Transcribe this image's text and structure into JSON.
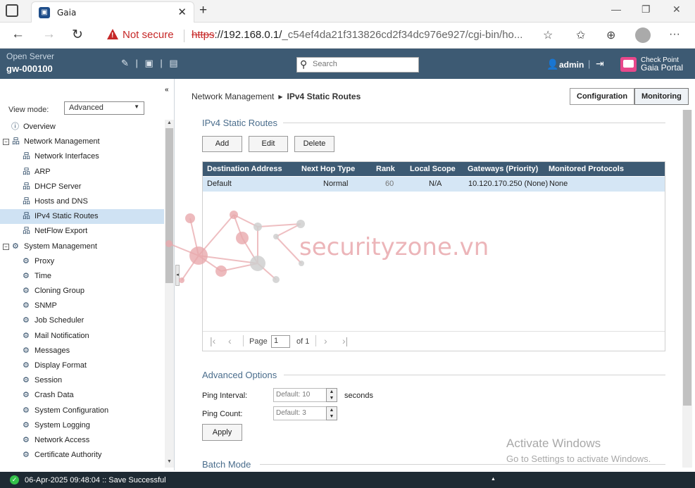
{
  "browser": {
    "tab_title": "Gaia",
    "not_secure": "Not secure",
    "url_scheme": "https",
    "url_host": "://192.168.0.1/",
    "url_path": "_c54ef4da21f313826cd2f34dc976e927/cgi-bin/ho..."
  },
  "header": {
    "server_type": "Open Server",
    "hostname": "gw-000100",
    "search_placeholder": "Search",
    "user": "admin",
    "brand_line1": "Check Point",
    "brand_line2": "Gaia Portal"
  },
  "sidebar": {
    "view_mode_label": "View mode:",
    "view_mode_value": "Advanced",
    "items": [
      {
        "label": "Overview"
      },
      {
        "label": "Network Management"
      },
      {
        "label": "Network Interfaces"
      },
      {
        "label": "ARP"
      },
      {
        "label": "DHCP Server"
      },
      {
        "label": "Hosts and DNS"
      },
      {
        "label": "IPv4 Static Routes"
      },
      {
        "label": "NetFlow Export"
      },
      {
        "label": "System Management"
      },
      {
        "label": "Proxy"
      },
      {
        "label": "Time"
      },
      {
        "label": "Cloning Group"
      },
      {
        "label": "SNMP"
      },
      {
        "label": "Job Scheduler"
      },
      {
        "label": "Mail Notification"
      },
      {
        "label": "Messages"
      },
      {
        "label": "Display Format"
      },
      {
        "label": "Session"
      },
      {
        "label": "Crash Data"
      },
      {
        "label": "System Configuration"
      },
      {
        "label": "System Logging"
      },
      {
        "label": "Network Access"
      },
      {
        "label": "Certificate Authority"
      }
    ]
  },
  "main": {
    "breadcrumb_parent": "Network Management",
    "breadcrumb_current": "IPv4 Static Routes",
    "configuration_label": "Configuration",
    "monitoring_label": "Monitoring",
    "section_title": "IPv4 Static Routes",
    "add_label": "Add",
    "edit_label": "Edit",
    "delete_label": "Delete",
    "columns": [
      "Destination Address",
      "Next Hop Type",
      "Rank",
      "Local Scope",
      "Gateways (Priority)",
      "Monitored Protocols"
    ],
    "rows": [
      [
        "Default",
        "Normal",
        "60",
        "N/A",
        "10.120.170.250 (None)",
        "None"
      ]
    ],
    "pager_page_label": "Page",
    "pager_page_value": "1",
    "pager_of": "of 1",
    "advanced_title": "Advanced Options",
    "ping_interval_label": "Ping Interval:",
    "ping_interval_placeholder": "Default: 10",
    "seconds_label": "seconds",
    "ping_count_label": "Ping Count:",
    "ping_count_placeholder": "Default: 3",
    "apply_label": "Apply",
    "batch_title": "Batch Mode"
  },
  "watermark": "securityzone.vn",
  "windows_activation": {
    "line1": "Activate Windows",
    "line2": "Go to Settings to activate Windows."
  },
  "status": {
    "message": "06-Apr-2025 09:48:04 :: Save Successful"
  },
  "colors": {
    "header_bg": "#3d5a73",
    "grid_header_bg": "#3d5a73",
    "selected_row_bg": "#d5e6f5",
    "section_title": "#4a6d8c",
    "status_bar_bg": "#1e2a33",
    "brand_accent": "#e8488b"
  }
}
